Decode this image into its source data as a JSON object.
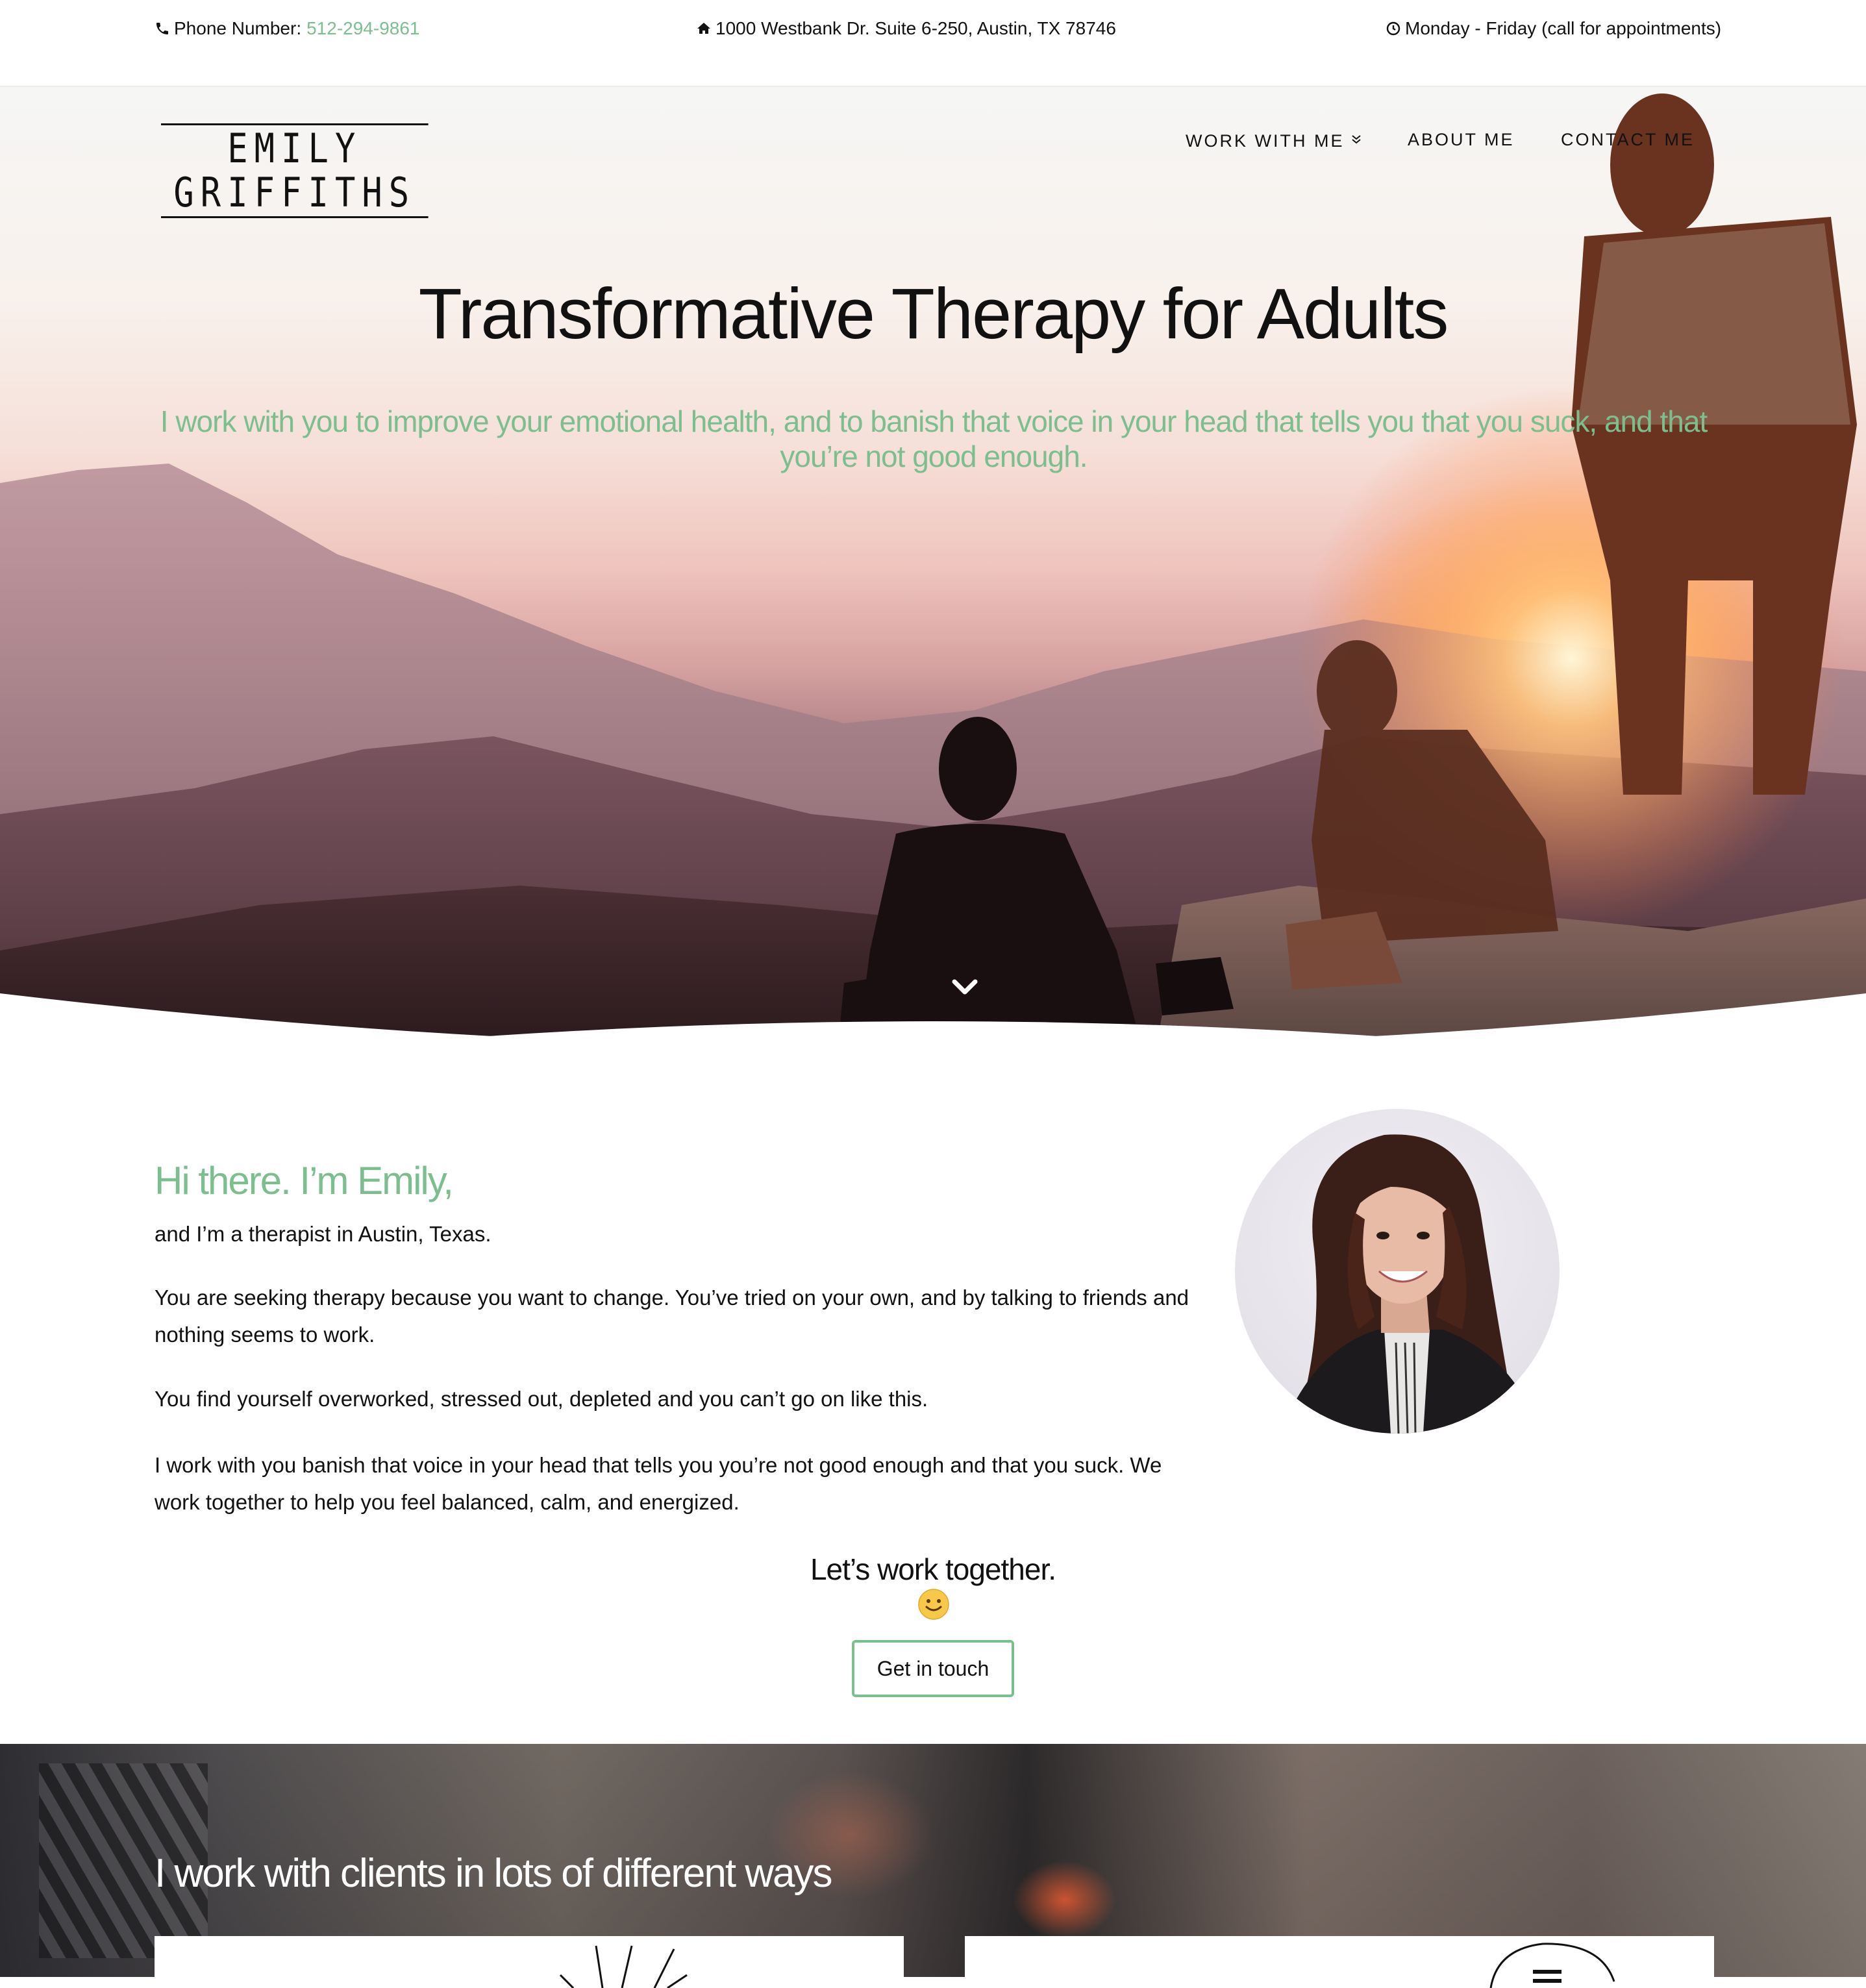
{
  "topbar": {
    "phone_label": "Phone Number:",
    "phone_number": "512-294-9861",
    "address": "1000 Westbank Dr. Suite 6-250, Austin, TX 78746",
    "hours": "Monday - Friday (call for appointments)"
  },
  "header": {
    "logo": "EMILY GRIFFITHS",
    "nav": [
      {
        "label": "WORK WITH ME",
        "has_dropdown": true
      },
      {
        "label": "ABOUT ME"
      },
      {
        "label": "CONTACT ME"
      }
    ]
  },
  "hero": {
    "title": "Transformative Therapy for Adults",
    "subtitle": "I work with you to improve your emotional health, and to banish that voice in your head that tells you that you suck, and that you’re not good enough."
  },
  "intro": {
    "heading": "Hi there. I’m Emily,",
    "paragraphs": [
      "and I’m a therapist in Austin, Texas.",
      "You are seeking therapy because you want to change. You’ve tried on your own, and by talking to friends and nothing seems to work.",
      "You find yourself overworked, stressed out, depleted and you can’t go on like this.",
      "I work with you banish that voice in your head that tells you you’re not good enough and that you suck. We work together to help you feel balanced, calm, and energized."
    ],
    "cta_heading": "Let’s work together.",
    "cta_button": "Get in touch"
  },
  "services": {
    "heading": "I work with clients in lots of different ways"
  },
  "colors": {
    "accent": "#7bbf8f",
    "text": "#111111",
    "background": "#ffffff"
  },
  "icons": [
    "phone-icon",
    "home-icon",
    "clock-icon",
    "chevron-down-icon",
    "double-chevron-icon",
    "smile-emoji-icon"
  ]
}
